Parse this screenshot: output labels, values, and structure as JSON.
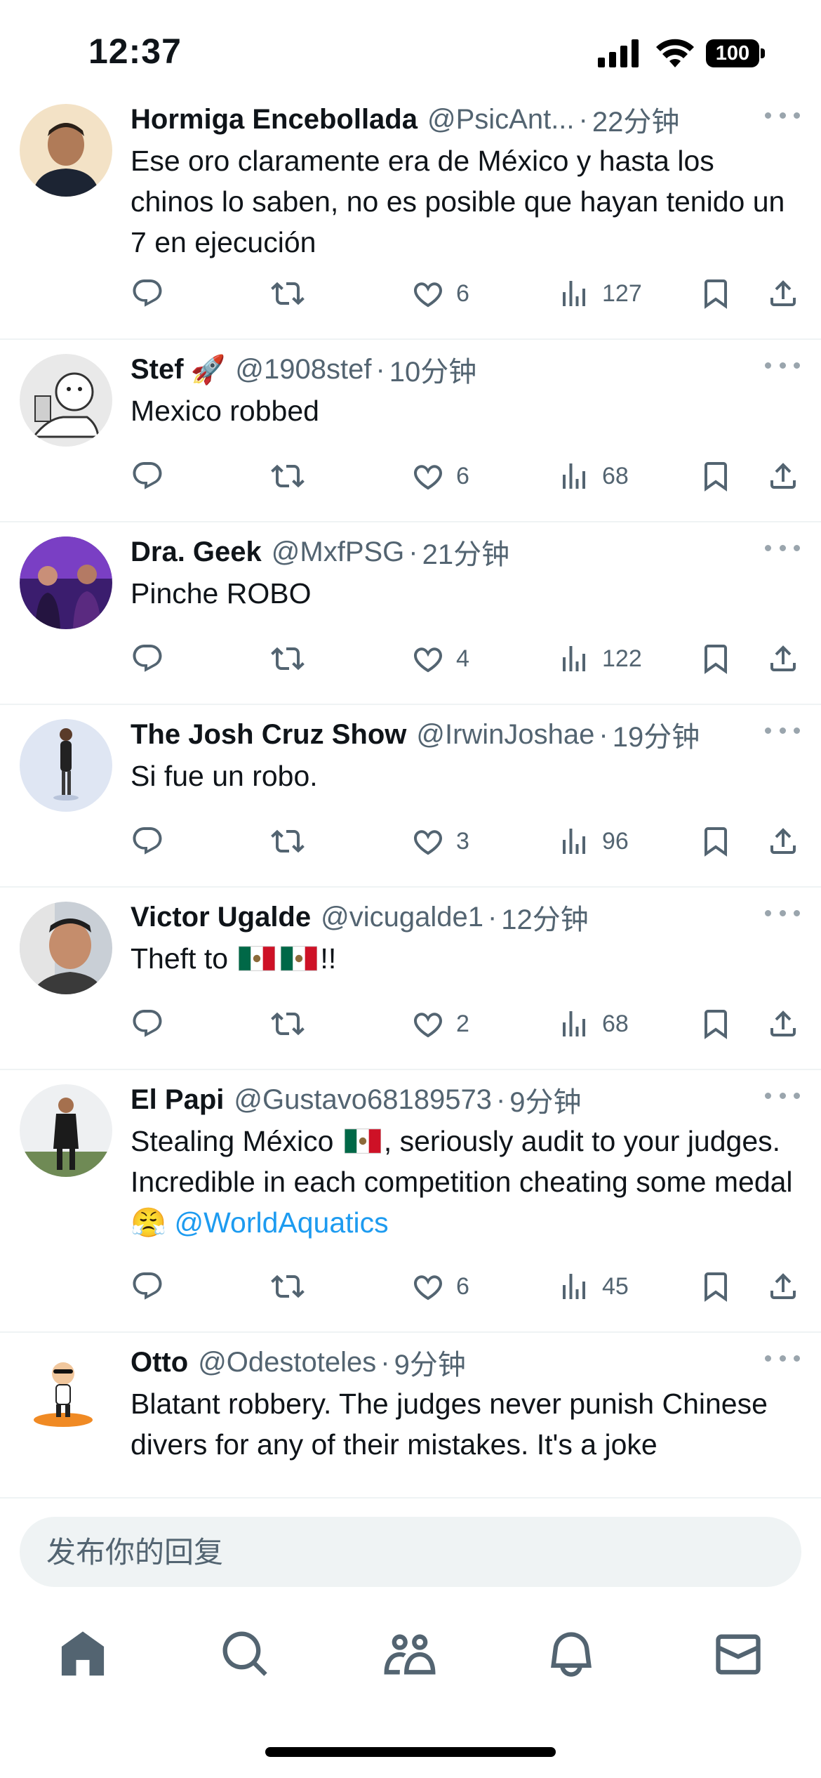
{
  "status": {
    "time": "12:37",
    "battery": "100"
  },
  "tweets": [
    {
      "name": "Hormiga Encebollada",
      "handle": "@PsicAnt...",
      "time": "22分钟",
      "text": "Ese oro claramente era de México y hasta los chinos lo saben, no es posible que hayan tenido un 7 en ejecución",
      "likes": "6",
      "views": "127"
    },
    {
      "name": "Stef",
      "name_emoji": "🚀",
      "handle": "@1908stef",
      "time": "10分钟",
      "text": "Mexico robbed",
      "likes": "6",
      "views": "68"
    },
    {
      "name": "Dra. Geek",
      "handle": "@MxfPSG",
      "time": "21分钟",
      "text": "Pinche ROBO",
      "likes": "4",
      "views": "122"
    },
    {
      "name": "The Josh Cruz Show",
      "handle": "@IrwinJoshae",
      "time": "19分钟",
      "text": "Si fue un robo.",
      "likes": "3",
      "views": "96"
    },
    {
      "name": "Victor Ugalde",
      "handle": "@vicugalde1",
      "time": "12分钟",
      "text_before": "Theft to",
      "text_after": "!!",
      "likes": "2",
      "views": "68"
    },
    {
      "name": "El Papi",
      "handle": "@Gustavo68189573",
      "time": "9分钟",
      "text_before": "Stealing México",
      "text_after": ", seriously audit to your judges. Incredible in each competition cheating some medal 😤",
      "mention": "@WorldAquatics",
      "likes": "6",
      "views": "45"
    },
    {
      "name": "Otto",
      "handle": "@Odestoteles",
      "time": "9分钟",
      "text": "Blatant robbery. The judges never punish Chinese divers for any of their mistakes. It's a joke"
    }
  ],
  "reply": {
    "placeholder": "发布你的回复"
  },
  "tabs": [
    "home-icon",
    "search-icon",
    "communities-icon",
    "notifications-icon",
    "messages-icon"
  ],
  "colors": {
    "accent": "#1d9bf0",
    "secondary_text": "#536471",
    "divider": "#eff3f4",
    "flag_green": "#006847",
    "flag_red": "#ce1126"
  }
}
